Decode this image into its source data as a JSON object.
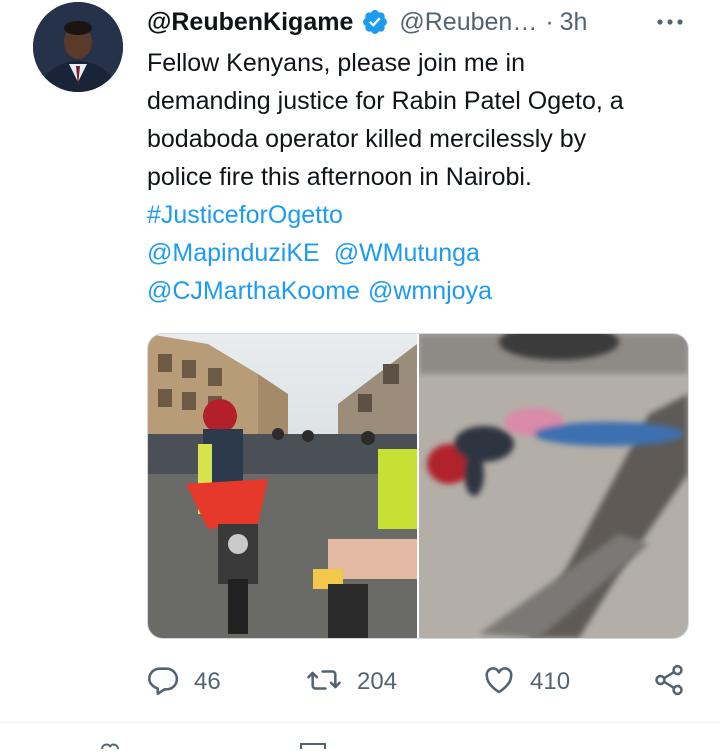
{
  "tweet": {
    "display_name": "@ReubenKigame",
    "handle": "@Reuben…",
    "separator": "·",
    "time": "3h",
    "verified": true,
    "body_lines": [
      "Fellow Kenyans, please join me in",
      "demanding justice for Rabin Patel Ogeto, a",
      "bodaboda operator killed mercilessly by",
      "police fire this afternoon in Nairobi."
    ],
    "hashtag": "#JusticeforOgetto",
    "mentions_line1": [
      "@MapinduziKE",
      "@WMutunga"
    ],
    "mentions_line2": [
      "@CJMarthaKoome",
      "@wmnjoya"
    ]
  },
  "actions": {
    "replies": "46",
    "retweets": "204",
    "likes": "410"
  },
  "icons": {
    "verified": "verified-badge-icon",
    "more": "more-horizontal-icon",
    "reply": "reply-icon",
    "retweet": "retweet-icon",
    "like": "heart-icon",
    "share": "share-icon"
  },
  "colors": {
    "accent": "#1d9bf0",
    "secondary_text": "#536471",
    "primary_text": "#0f1419"
  }
}
